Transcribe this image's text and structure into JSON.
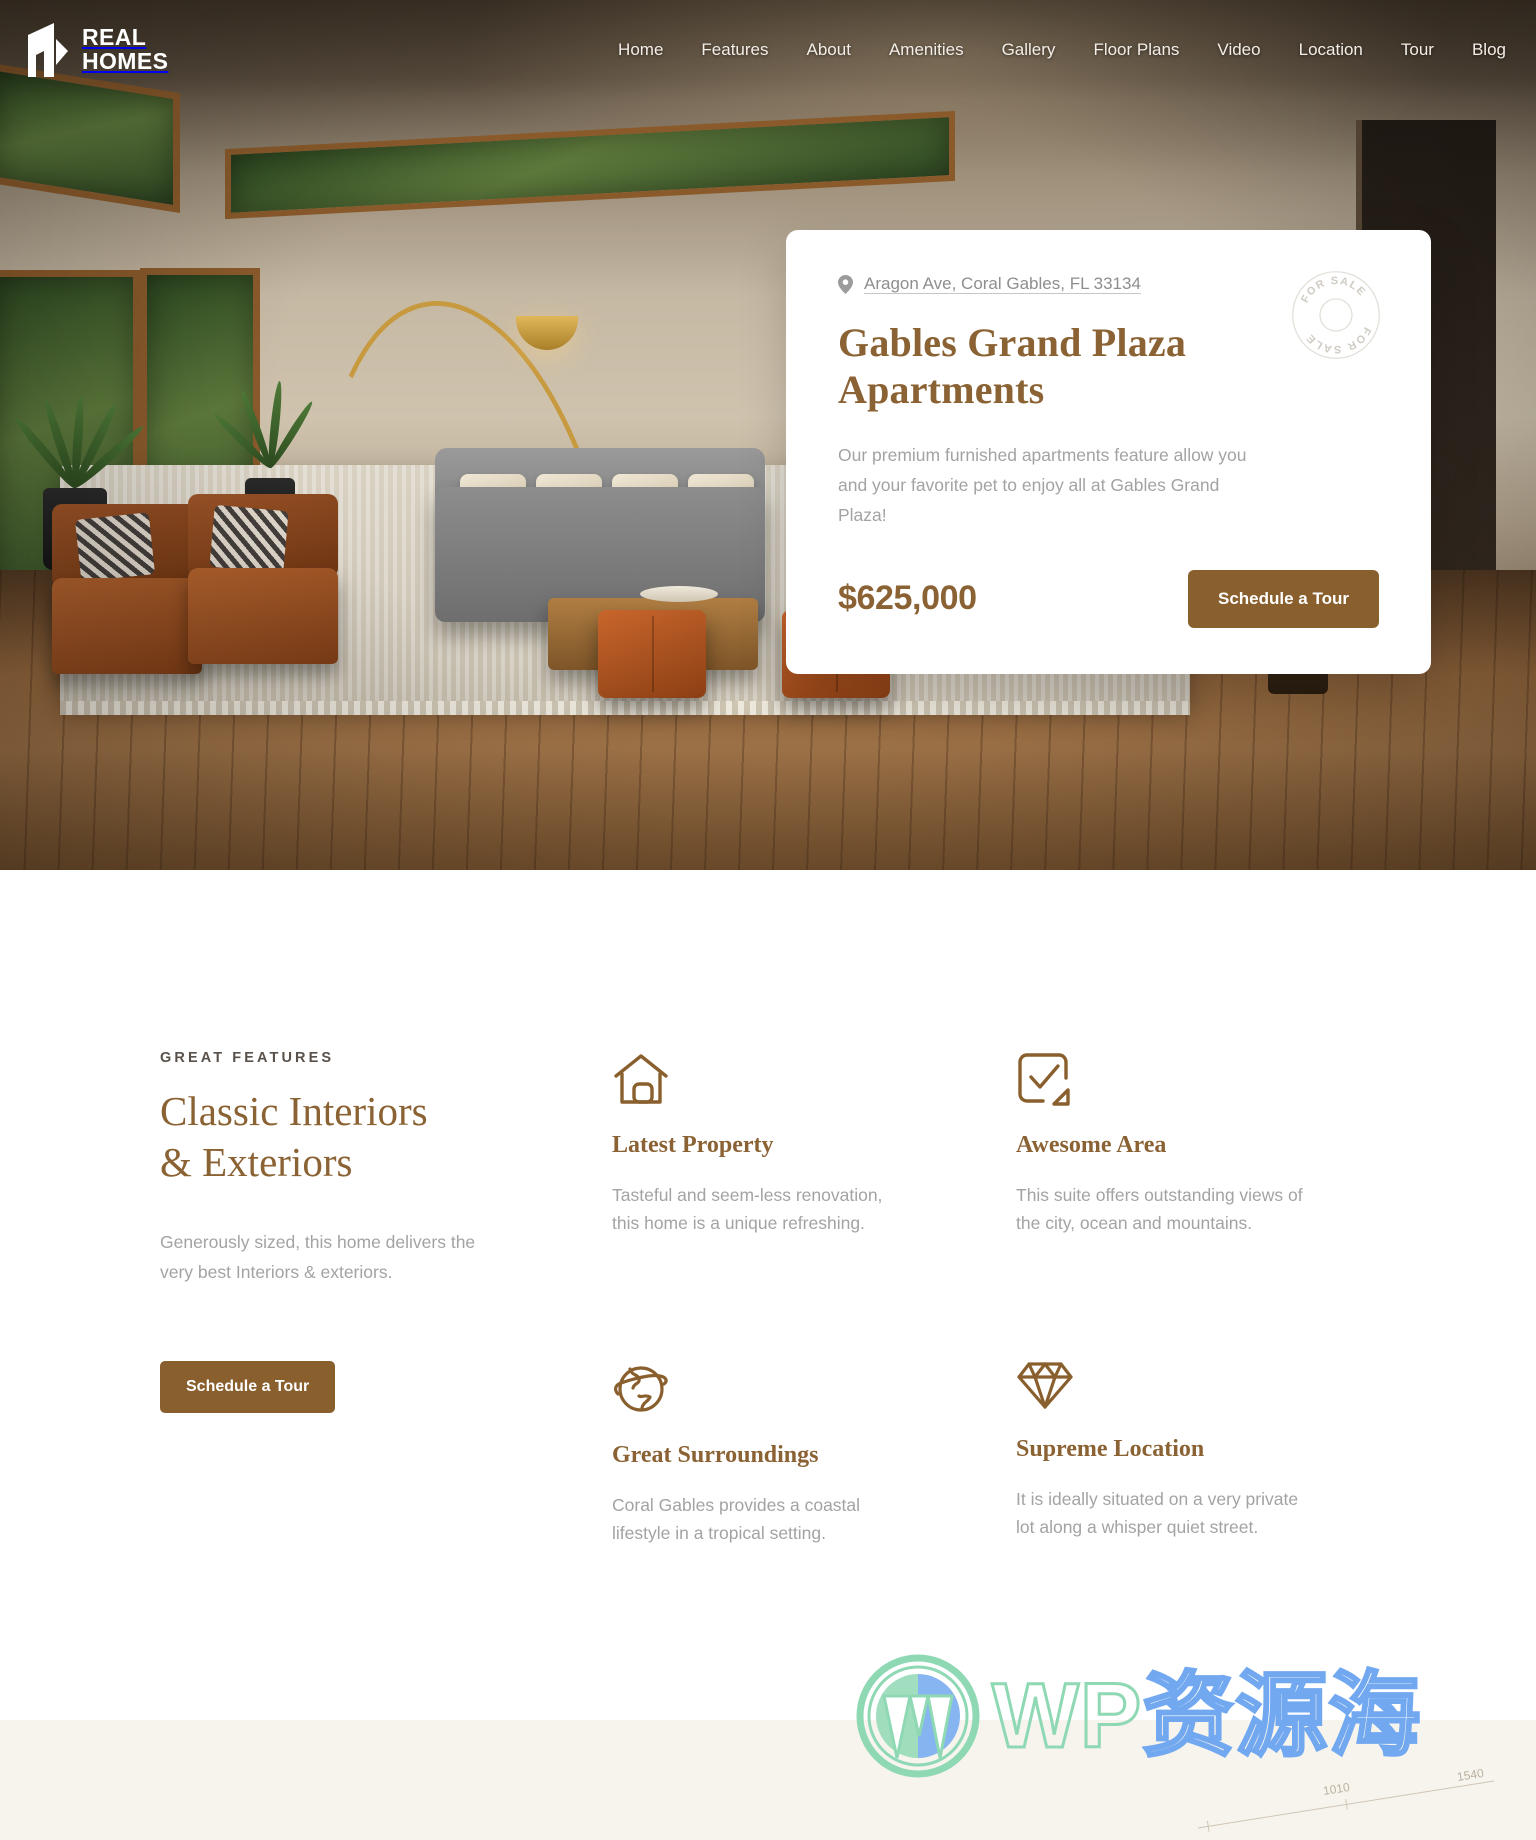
{
  "brand": {
    "line1": "REAL",
    "line2": "HOMES",
    "logo_icon": "door-logo-icon"
  },
  "nav": {
    "items": [
      {
        "label": "Home"
      },
      {
        "label": "Features"
      },
      {
        "label": "About"
      },
      {
        "label": "Amenities"
      },
      {
        "label": "Gallery"
      },
      {
        "label": "Floor Plans"
      },
      {
        "label": "Video"
      },
      {
        "label": "Location"
      },
      {
        "label": "Tour"
      },
      {
        "label": "Blog"
      }
    ]
  },
  "hero": {
    "card": {
      "address": "Aragon Ave, Coral Gables, FL 33134",
      "address_icon": "map-pin-icon",
      "title": "Gables Grand Plaza Apartments",
      "description": "Our premium furnished apartments feature allow you and your favorite pet to enjoy all at Gables Grand Plaza!",
      "price": "$625,000",
      "cta_label": "Schedule a Tour",
      "badge_text": "FOR SALE",
      "badge_icon": "for-sale-seal-icon"
    }
  },
  "features": {
    "eyebrow": "GREAT FEATURES",
    "title_line1": "Classic Interiors",
    "title_line2": "& Exteriors",
    "subtitle": "Generously sized, this home delivers the very best Interiors & exteriors.",
    "cta_label": "Schedule a Tour",
    "items": [
      {
        "icon": "house-outline-icon",
        "name": "Latest Property",
        "text": "Tasteful and seem-less renovation, this home is a unique refreshing."
      },
      {
        "icon": "check-square-icon",
        "name": "Awesome Area",
        "text": "This suite offers outstanding views of the city, ocean and mountains."
      },
      {
        "icon": "globe-ring-icon",
        "name": "Great Surroundings",
        "text": "Coral Gables provides a coastal lifestyle in a tropical setting."
      },
      {
        "icon": "diamond-icon",
        "name": "Supreme Location",
        "text": "It is ideally situated on a very private lot along a whisper quiet street."
      }
    ]
  },
  "bottom_band": {
    "dimension_labels": [
      "1010",
      "1540"
    ]
  },
  "watermark": {
    "logo_icon": "wordpress-logo-icon",
    "text_latin": "WP",
    "text_cjk": "资源海"
  },
  "colors": {
    "brand_brown": "#8a6233",
    "button_brown": "#8a5f2e",
    "muted_text": "#a3a3a3",
    "band_cream": "#f7f4ee",
    "card_white": "#ffffff"
  }
}
